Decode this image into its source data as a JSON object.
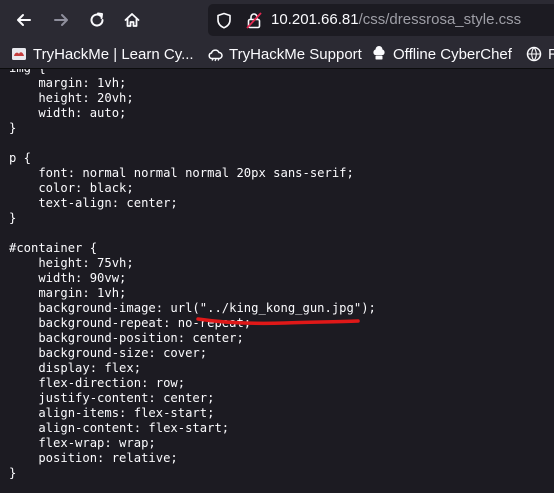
{
  "browser": {
    "url_host": "10.201.66.81",
    "url_path": "/css/dressrosa_style.css"
  },
  "icons": [
    "back-arrow-icon",
    "forward-arrow-icon",
    "reload-icon",
    "home-icon",
    "shield-icon",
    "lock-icon",
    "bookmark-favicon",
    "cloud-icon",
    "chef-hat-icon"
  ],
  "bookmarks": [
    {
      "label": "TryHackMe | Learn Cy...",
      "icon": "tryhackme-favicon"
    },
    {
      "label": "TryHackMe Support",
      "icon": "cloud-icon"
    },
    {
      "label": "Offline CyberChef",
      "icon": "chef-hat-icon"
    },
    {
      "label": "R",
      "icon": "bookmark-favicon"
    }
  ],
  "code_lines": [
    "img {",
    "    margin: 1vh;",
    "    height: 20vh;",
    "    width: auto;",
    "}",
    "",
    "p {",
    "    font: normal normal normal 20px sans-serif;",
    "    color: black;",
    "    text-align: center;",
    "}",
    "",
    "#container {",
    "    height: 75vh;",
    "    width: 90vw;",
    "    margin: 1vh;",
    "    background-image: url(\"../king_kong_gun.jpg\");",
    "    background-repeat: no-repeat;",
    "    background-position: center;",
    "    background-size: cover;",
    "    display: flex;",
    "    flex-direction: row;",
    "    justify-content: center;",
    "    align-items: flex-start;",
    "    align-content: flex-start;",
    "    flex-wrap: wrap;",
    "    position: relative;",
    "}"
  ],
  "colors": {
    "toolbar_bg": "#2b2a33",
    "page_bg": "#1c1b22",
    "text": "#fbfbfe",
    "annotation_underline": "#e01818"
  }
}
